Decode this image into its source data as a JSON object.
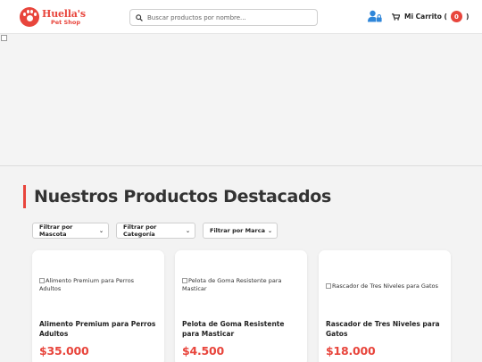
{
  "header": {
    "logo": {
      "title": "Huella's",
      "subtitle": "Pet Shop"
    },
    "search": {
      "placeholder": "Buscar productos por nombre..."
    },
    "cart": {
      "label": "Mi Carrito (",
      "count": "0",
      "close": ")"
    }
  },
  "colors": {
    "accent": "#e8453c",
    "user_icon": "#2f86d9"
  },
  "hero": {
    "image": "broken-image-icon"
  },
  "section": {
    "title": "Nuestros Productos Destacados"
  },
  "filters": [
    {
      "label": "Filtrar por Mascota"
    },
    {
      "label": "Filtrar por Categoría"
    },
    {
      "label": "Filtrar por Marca"
    }
  ],
  "products": [
    {
      "img_alt": "Alimento Premium para Perros Adultos",
      "name": "Alimento Premium para Perros Adultos",
      "price": "$35.000"
    },
    {
      "img_alt": "Pelota de Goma Resistente para Masticar",
      "name": "Pelota de Goma Resistente para Masticar",
      "price": "$4.500"
    },
    {
      "img_alt": "Rascador de Tres Niveles para Gatos",
      "name": "Rascador de Tres Niveles para Gatos",
      "price": "$18.000"
    }
  ]
}
